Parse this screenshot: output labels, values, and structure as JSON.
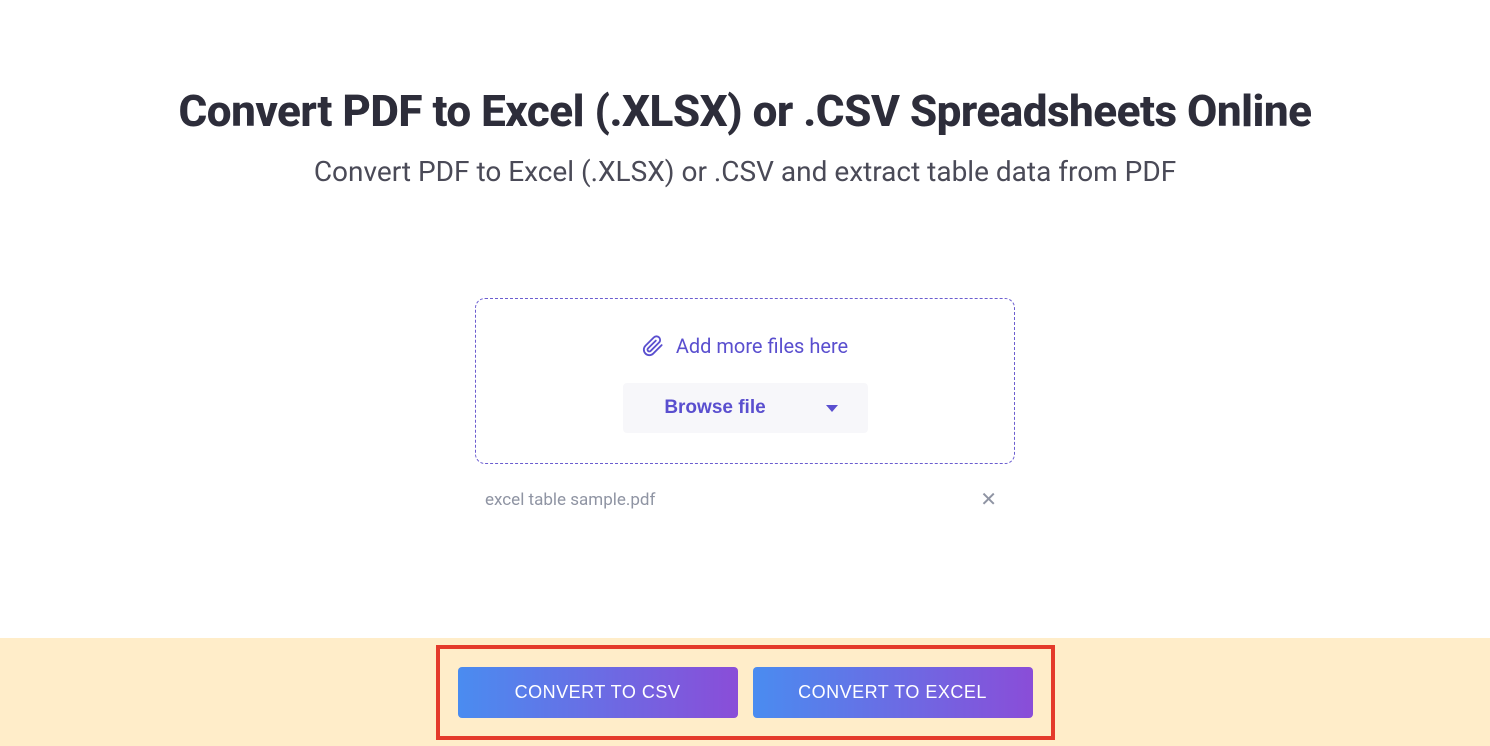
{
  "header": {
    "title": "Convert PDF to Excel (.XLSX) or .CSV Spreadsheets Online",
    "subtitle": "Convert PDF to Excel (.XLSX) or .CSV and extract table data from PDF"
  },
  "upload": {
    "add_more_label": "Add more files here",
    "browse_label": "Browse file"
  },
  "files": [
    {
      "name": "excel table sample.pdf"
    }
  ],
  "actions": {
    "convert_csv_label": "CONVERT TO CSV",
    "convert_excel_label": "CONVERT TO EXCEL"
  }
}
